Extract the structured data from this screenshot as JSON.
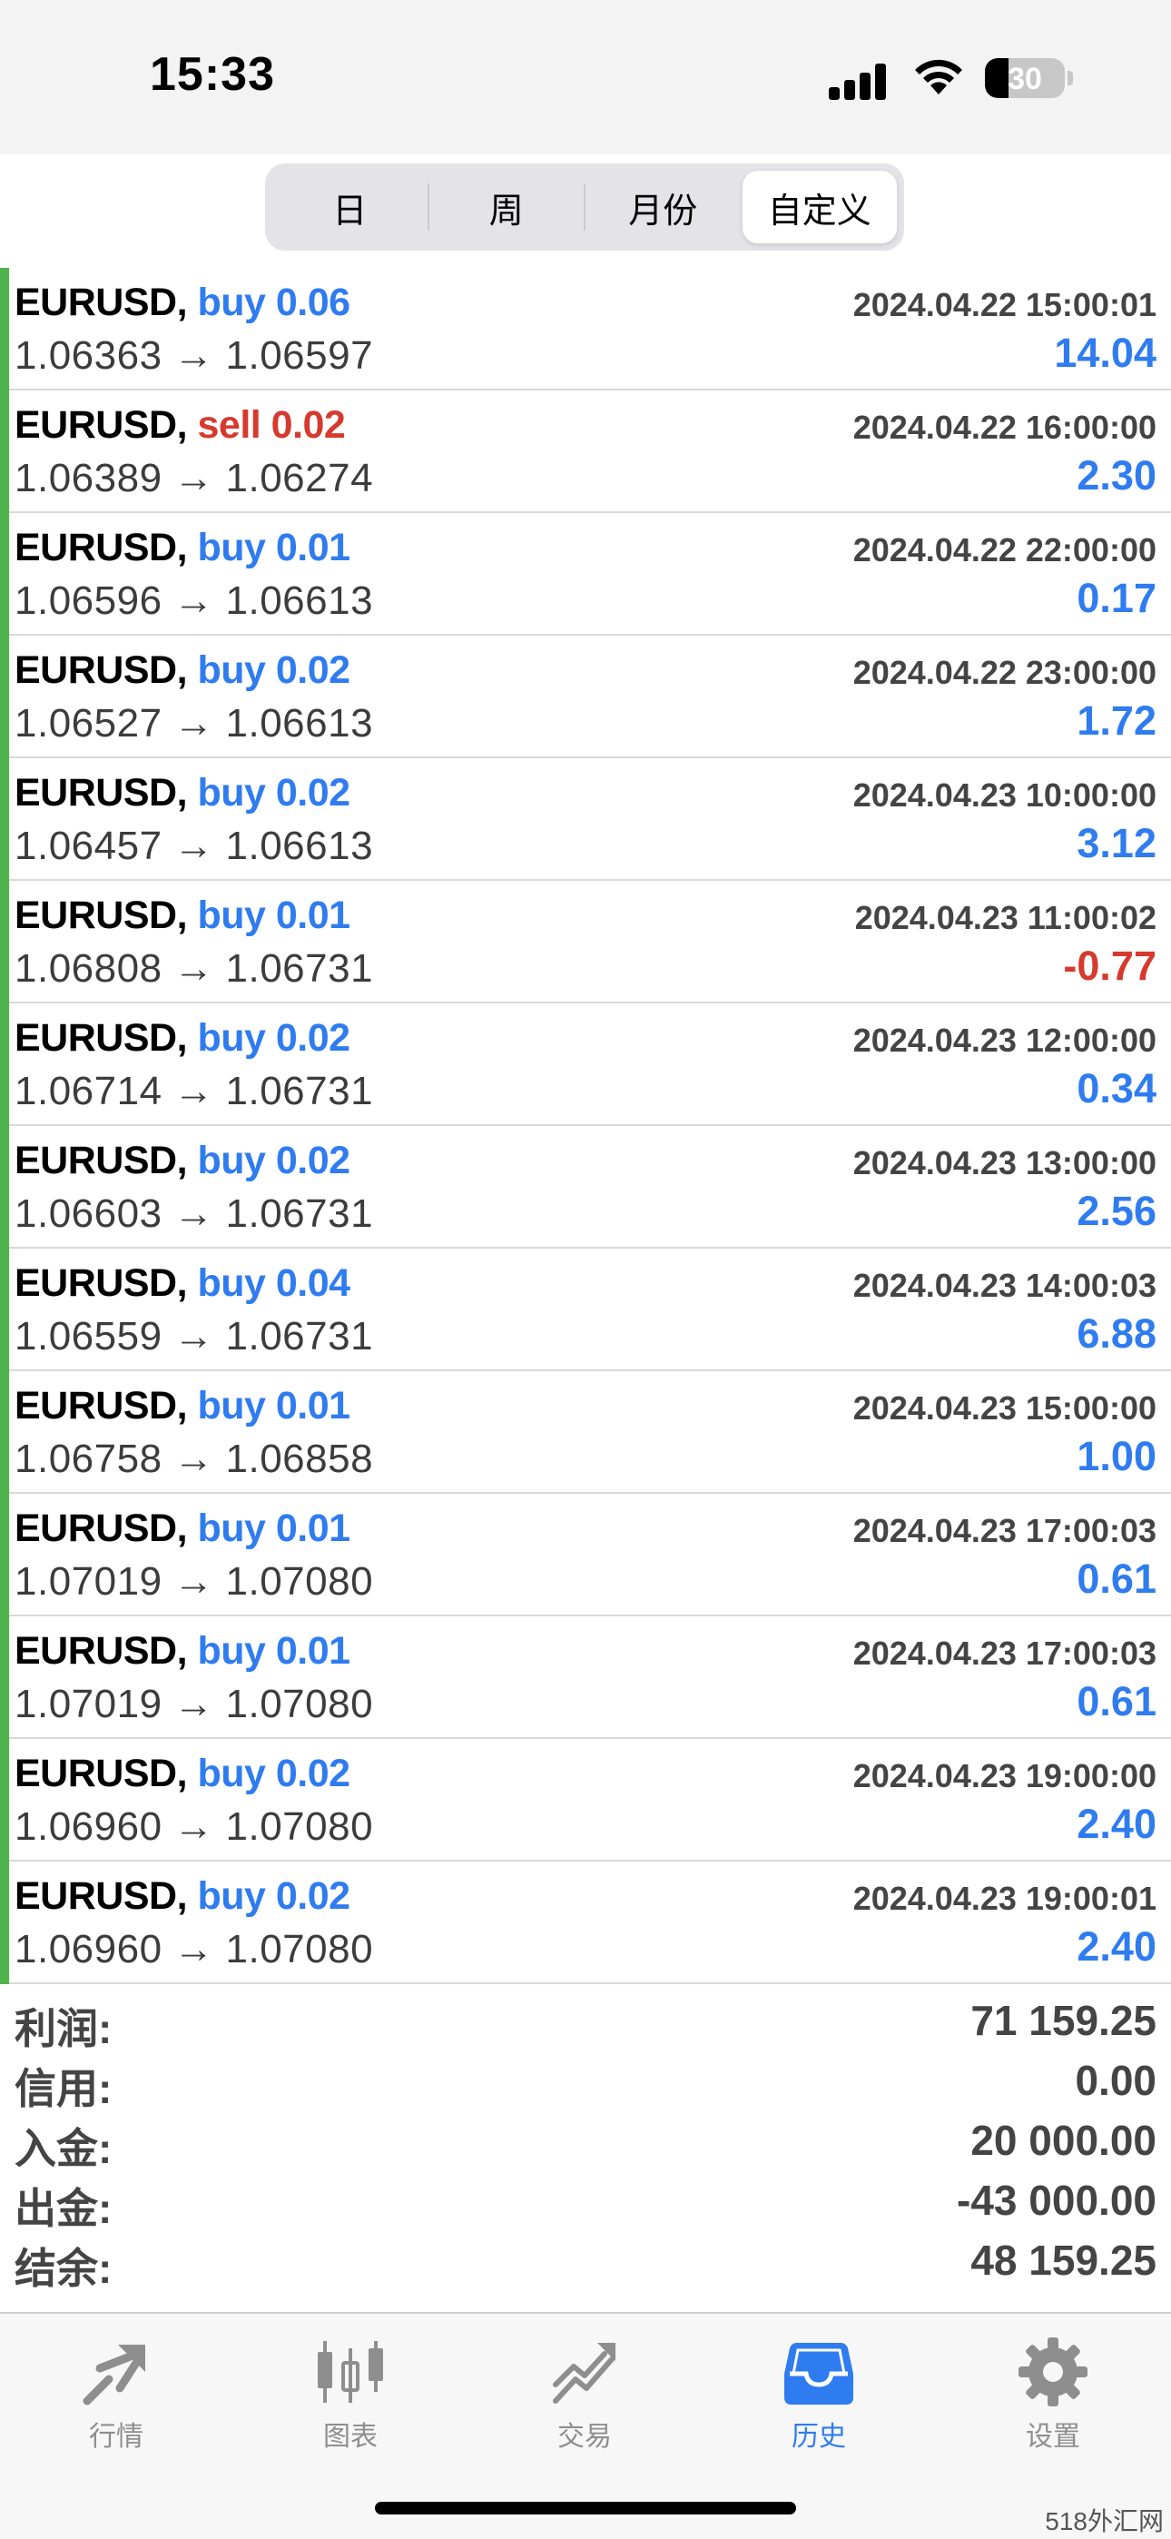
{
  "status_bar": {
    "time": "15:33",
    "battery": "30",
    "battery_level": 0.3
  },
  "segmented": {
    "tabs": [
      "日",
      "周",
      "月份",
      "自定义"
    ],
    "active_index": 3
  },
  "trades": [
    {
      "symbol": "EURUSD,",
      "side": "buy",
      "side_label": "buy 0.06",
      "prices": "1.06363 → 1.06597",
      "time": "2024.04.22 15:00:01",
      "profit": "14.04"
    },
    {
      "symbol": "EURUSD,",
      "side": "sell",
      "side_label": "sell 0.02",
      "prices": "1.06389 → 1.06274",
      "time": "2024.04.22 16:00:00",
      "profit": "2.30"
    },
    {
      "symbol": "EURUSD,",
      "side": "buy",
      "side_label": "buy 0.01",
      "prices": "1.06596 → 1.06613",
      "time": "2024.04.22 22:00:00",
      "profit": "0.17"
    },
    {
      "symbol": "EURUSD,",
      "side": "buy",
      "side_label": "buy 0.02",
      "prices": "1.06527 → 1.06613",
      "time": "2024.04.22 23:00:00",
      "profit": "1.72"
    },
    {
      "symbol": "EURUSD,",
      "side": "buy",
      "side_label": "buy 0.02",
      "prices": "1.06457 → 1.06613",
      "time": "2024.04.23 10:00:00",
      "profit": "3.12"
    },
    {
      "symbol": "EURUSD,",
      "side": "buy",
      "side_label": "buy 0.01",
      "prices": "1.06808 → 1.06731",
      "time": "2024.04.23 11:00:02",
      "profit": "-0.77"
    },
    {
      "symbol": "EURUSD,",
      "side": "buy",
      "side_label": "buy 0.02",
      "prices": "1.06714 → 1.06731",
      "time": "2024.04.23 12:00:00",
      "profit": "0.34"
    },
    {
      "symbol": "EURUSD,",
      "side": "buy",
      "side_label": "buy 0.02",
      "prices": "1.06603 → 1.06731",
      "time": "2024.04.23 13:00:00",
      "profit": "2.56"
    },
    {
      "symbol": "EURUSD,",
      "side": "buy",
      "side_label": "buy 0.04",
      "prices": "1.06559 → 1.06731",
      "time": "2024.04.23 14:00:03",
      "profit": "6.88"
    },
    {
      "symbol": "EURUSD,",
      "side": "buy",
      "side_label": "buy 0.01",
      "prices": "1.06758 → 1.06858",
      "time": "2024.04.23 15:00:00",
      "profit": "1.00"
    },
    {
      "symbol": "EURUSD,",
      "side": "buy",
      "side_label": "buy 0.01",
      "prices": "1.07019 → 1.07080",
      "time": "2024.04.23 17:00:03",
      "profit": "0.61"
    },
    {
      "symbol": "EURUSD,",
      "side": "buy",
      "side_label": "buy 0.01",
      "prices": "1.07019 → 1.07080",
      "time": "2024.04.23 17:00:03",
      "profit": "0.61"
    },
    {
      "symbol": "EURUSD,",
      "side": "buy",
      "side_label": "buy 0.02",
      "prices": "1.06960 → 1.07080",
      "time": "2024.04.23 19:00:00",
      "profit": "2.40"
    },
    {
      "symbol": "EURUSD,",
      "side": "buy",
      "side_label": "buy 0.02",
      "prices": "1.06960 → 1.07080",
      "time": "2024.04.23 19:00:01",
      "profit": "2.40"
    }
  ],
  "summary": [
    {
      "label": "利润:",
      "value": "71 159.25"
    },
    {
      "label": "信用:",
      "value": "0.00"
    },
    {
      "label": "入金:",
      "value": "20 000.00"
    },
    {
      "label": "出金:",
      "value": "-43 000.00"
    },
    {
      "label": "结余:",
      "value": "48 159.25"
    }
  ],
  "tabbar": {
    "items": [
      {
        "label": "行情",
        "icon": "quotes-icon"
      },
      {
        "label": "图表",
        "icon": "chart-candles-icon"
      },
      {
        "label": "交易",
        "icon": "trade-icon"
      },
      {
        "label": "历史",
        "icon": "history-inbox-icon"
      },
      {
        "label": "设置",
        "icon": "gear-icon"
      }
    ],
    "active_index": 3
  },
  "watermark": "518外汇网",
  "colors": {
    "buy": "#2f7cf0",
    "sell": "#d63a2e",
    "accent": "#2f7cf0",
    "edge_bar": "#4db34a"
  }
}
